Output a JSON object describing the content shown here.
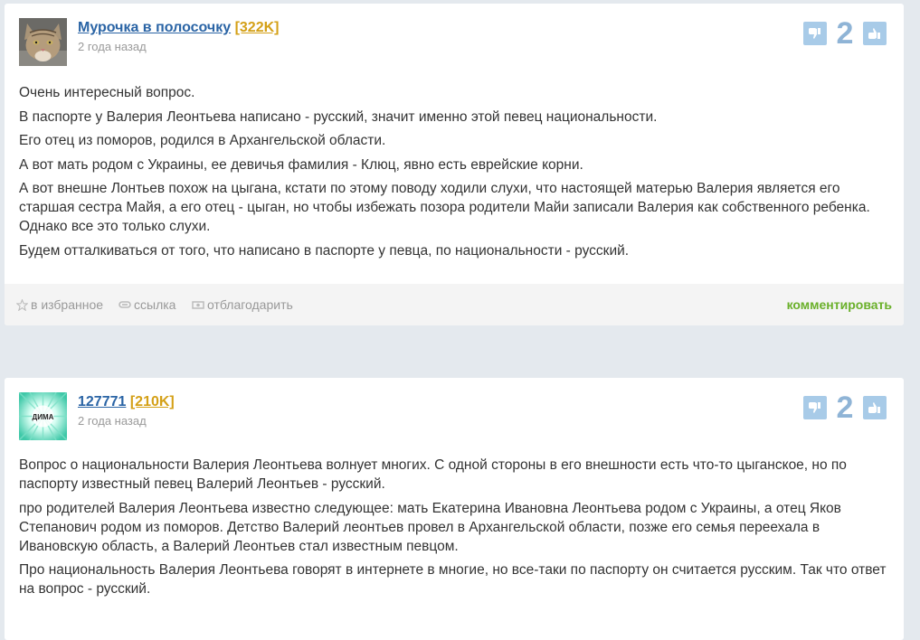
{
  "answers": [
    {
      "author": "Мурочка в полосочку",
      "reputation": "[322K]",
      "date": "2 года назад",
      "votes": "2",
      "avatar_icon": "cat-avatar",
      "paragraphs": [
        "Очень интересный вопрос.",
        "В паспорте у Валерия Леонтьева написано - русский, значит именно этой певец национальности.",
        "Его отец из поморов, родился в Архангельской области.",
        "А вот мать родом с Украины, ее девичья фамилия - Клюц, явно есть еврейские корни.",
        "А вот внешне Лонтьев похож на цыгана, кстати по этому поводу ходили слухи, что настоящей матерью Валерия является его старшая сестра Майя, а его отец - цыган, но чтобы избежать позора родители Майи записали Валерия как собственного ребенка. Однако все это только слухи.",
        "Будем отталкиваться от того, что написано в паспорте у певца, по национальности - русский."
      ],
      "footer": {
        "favorite": "в избранное",
        "link": "ссылка",
        "thank": "отблагодарить",
        "comment": "комментировать"
      }
    },
    {
      "author": "127771",
      "reputation": "[210K]",
      "date": "2 года назад",
      "votes": "2",
      "avatar_icon": "dima-avatar",
      "avatar_text": "ДИМА",
      "paragraphs": [
        "Вопрос о национальности Валерия Леонтьева волнует многих. С одной стороны в его внешности есть что-то цыганское, но по паспорту известный певец Валерий Леонтьев - русский.",
        "про родителей Валерия Леонтьева известно следующее: мать Екатерина Ивановна Леонтьева родом с Украины, а отец Яков Степанович родом из поморов. Детство Валерий леонтьев провел в Архангельской области, позже его семья переехала в Ивановскую область, а Валерий Леонтьев стал известным певцом.",
        "Про национальность Валерия Леонтьева говорят в интернете в многие, но все-таки по паспорту он считается русским. Так что ответ на вопрос - русский."
      ]
    }
  ],
  "colors": {
    "link": "#2a64a5",
    "reputation": "#d4a017",
    "vote_button": "#a8cbe8",
    "comment": "#6ab02a"
  }
}
